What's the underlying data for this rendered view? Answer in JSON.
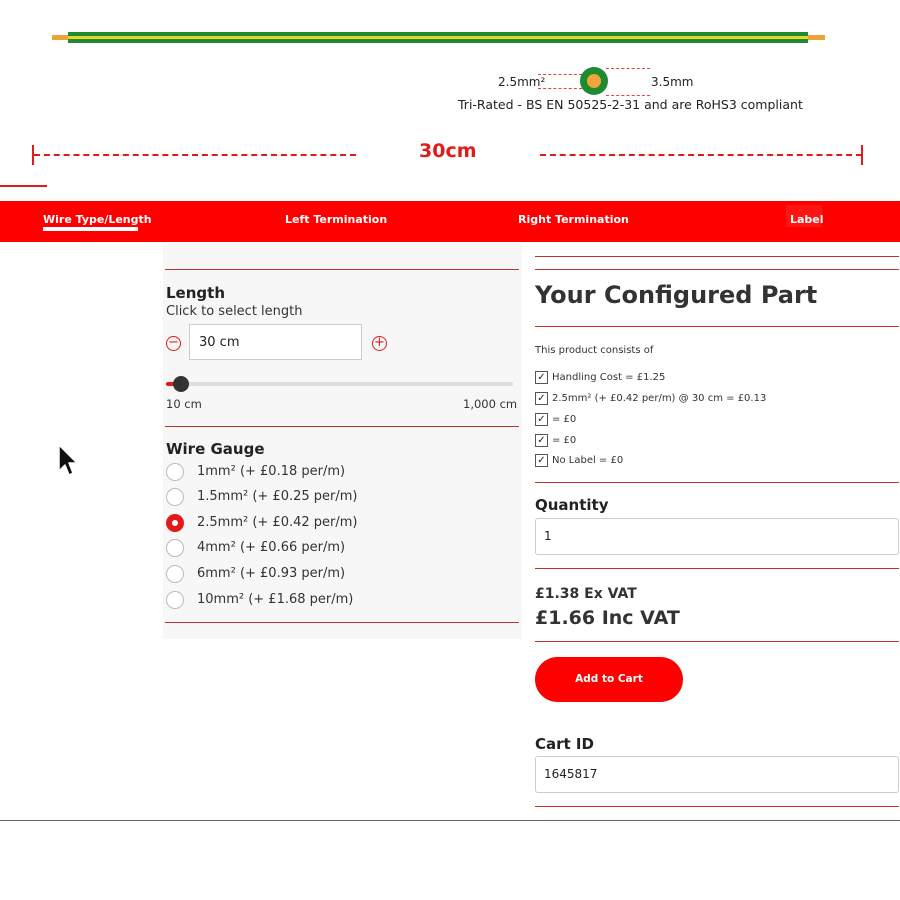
{
  "preview": {
    "gauge_label": "2.5mm²",
    "diameter_label": "3.5mm",
    "compliance": "Tri-Rated - BS EN 50525-2-31 and are RoHS3 compliant",
    "length_label": "30cm",
    "colors": {
      "insulation": "#1e8b2e",
      "stripe": "#e8d32b",
      "conductor": "#e9a43a",
      "accent": "#e21a1a"
    }
  },
  "tabs": [
    {
      "label": "Wire Type/Length",
      "active": true
    },
    {
      "label": "Left Termination",
      "active": false
    },
    {
      "label": "Right Termination",
      "active": false
    },
    {
      "label": "Label",
      "active": false
    }
  ],
  "length": {
    "heading": "Length",
    "hint": "Click to select length",
    "value": "30 cm",
    "slider_min_label": "10 cm",
    "slider_max_label": "1,000 cm",
    "slider_fraction": 0.02
  },
  "wire_gauge": {
    "heading": "Wire Gauge",
    "options": [
      {
        "label": "1mm² (+ £0.18 per/m)",
        "selected": false
      },
      {
        "label": "1.5mm² (+ £0.25 per/m)",
        "selected": false
      },
      {
        "label": "2.5mm² (+ £0.42 per/m)",
        "selected": true
      },
      {
        "label": "4mm² (+ £0.66 per/m)",
        "selected": false
      },
      {
        "label": "6mm² (+ £0.93 per/m)",
        "selected": false
      },
      {
        "label": "10mm² (+ £1.68 per/m)",
        "selected": false
      }
    ]
  },
  "configured": {
    "title": "Your Configured Part",
    "consists_of": "This product consists of",
    "items": [
      "Handling Cost = £1.25",
      "2.5mm² (+ £0.42 per/m) @ 30 cm = £0.13",
      "= £0",
      "= £0",
      "No Label = £0"
    ],
    "quantity_label": "Quantity",
    "quantity_value": "1",
    "price_ex": "£1.38 Ex VAT",
    "price_inc": "£1.66 Inc VAT",
    "add_to_cart": "Add to Cart",
    "cart_id_label": "Cart ID",
    "cart_id_value": "1645817"
  },
  "icons": [
    "mouse-cursor-icon",
    "minus-circle-icon",
    "plus-circle-icon",
    "checkbox-icon"
  ]
}
